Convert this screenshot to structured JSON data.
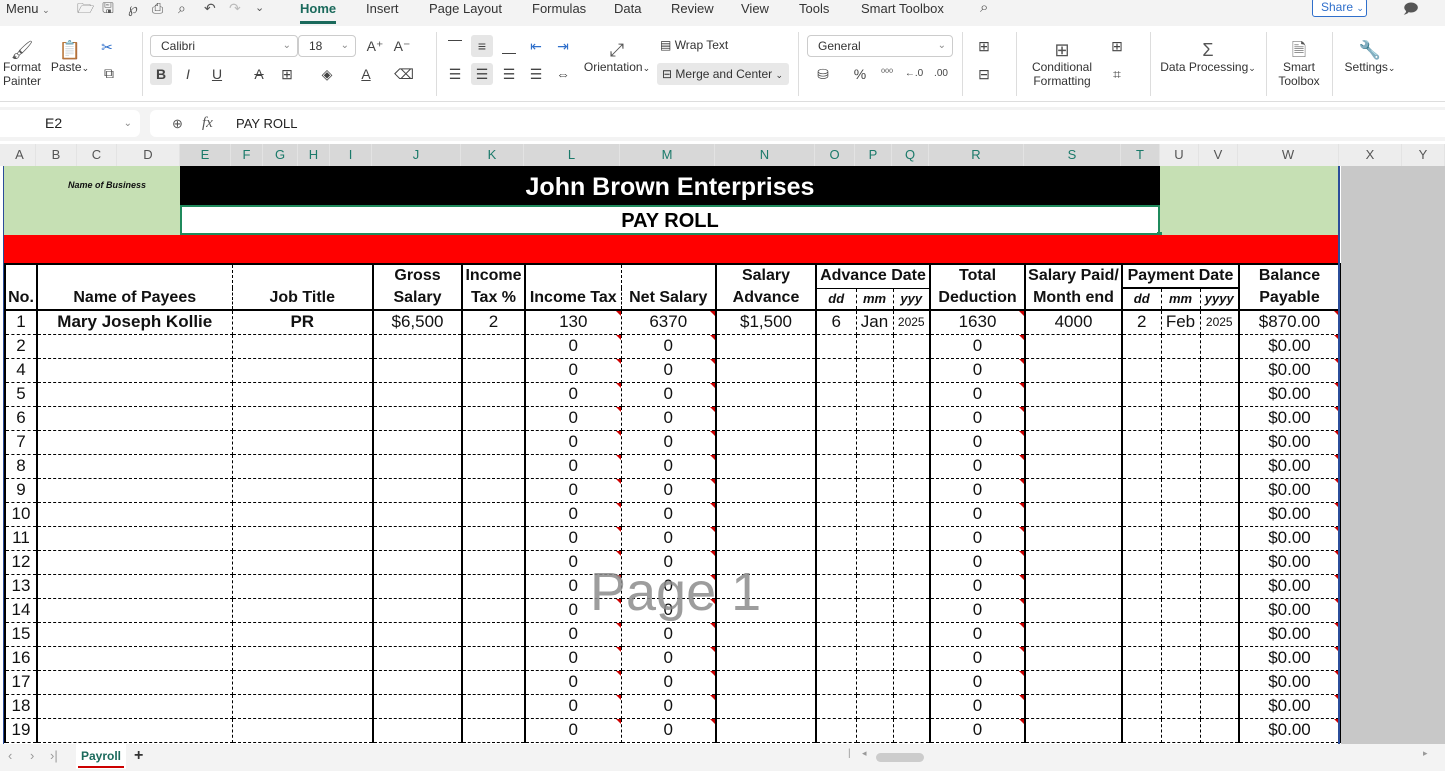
{
  "menubar": {
    "menu_label": "Menu",
    "tabs": [
      "Home",
      "Insert",
      "Page Layout",
      "Formulas",
      "Data",
      "Review",
      "View",
      "Tools",
      "Smart Toolbox"
    ],
    "active_tab": "Home",
    "share_label": "Share"
  },
  "ribbon": {
    "format_painter": "Format Painter",
    "paste": "Paste",
    "font_name": "Calibri",
    "font_size": "18",
    "wrap_text": "Wrap Text",
    "orientation": "Orientation",
    "merge_center": "Merge and Center",
    "number_format": "General",
    "conditional_formatting": "Conditional Formatting",
    "data_processing": "Data Processing",
    "smart_toolbox": "Smart Toolbox",
    "settings": "Settings"
  },
  "formula_bar": {
    "cell_ref": "E2",
    "fx": "fx",
    "content": "PAY ROLL"
  },
  "columns": [
    "A",
    "B",
    "C",
    "D",
    "E",
    "F",
    "G",
    "H",
    "I",
    "J",
    "K",
    "L",
    "M",
    "N",
    "O",
    "P",
    "Q",
    "R",
    "S",
    "T",
    "U",
    "V",
    "W",
    "X",
    "Y"
  ],
  "sheet": {
    "name_of_business_label": "Name of Business",
    "business_name": "John Brown Enterprises",
    "subtitle": "PAY ROLL",
    "watermark": "Page 1",
    "headers": {
      "no": "No.",
      "name": "Name of Payees",
      "job": "Job Title",
      "gross1": "Gross",
      "gross2": "Salary",
      "tax1": "Income",
      "tax2": "Tax %",
      "income_tax": "Income Tax",
      "net": "Net Salary",
      "adv1": "Salary",
      "adv2": "Advance",
      "adv_date": "Advance Date",
      "adv_dd": "dd",
      "adv_mm": "mm",
      "adv_yy": "yyy",
      "ded1": "Total",
      "ded2": "Deduction",
      "paid1": "Salary Paid/",
      "paid2": "Month end",
      "pay_date": "Payment Date",
      "pay_dd": "dd",
      "pay_mm": "mm",
      "pay_yy": "yyyy",
      "bal1": "Balance",
      "bal2": "Payable"
    },
    "rows": [
      {
        "no": "1",
        "name": "Mary Joseph Kollie",
        "job": "PR",
        "gross": "$6,500",
        "tax_pct": "2",
        "income_tax": "130",
        "net": "6370",
        "advance": "$1,500",
        "adv_dd": "6",
        "adv_mm": "Jan",
        "adv_yy": "2025",
        "total_ded": "1630",
        "paid": "4000",
        "pay_dd": "2",
        "pay_mm": "Feb",
        "pay_yy": "2025",
        "balance": "$870.00"
      },
      {
        "no": "2",
        "income_tax": "0",
        "net": "0",
        "total_ded": "0",
        "balance": "$0.00"
      },
      {
        "no": "4",
        "income_tax": "0",
        "net": "0",
        "total_ded": "0",
        "balance": "$0.00"
      },
      {
        "no": "5",
        "income_tax": "0",
        "net": "0",
        "total_ded": "0",
        "balance": "$0.00"
      },
      {
        "no": "6",
        "income_tax": "0",
        "net": "0",
        "total_ded": "0",
        "balance": "$0.00"
      },
      {
        "no": "7",
        "income_tax": "0",
        "net": "0",
        "total_ded": "0",
        "balance": "$0.00"
      },
      {
        "no": "8",
        "income_tax": "0",
        "net": "0",
        "total_ded": "0",
        "balance": "$0.00"
      },
      {
        "no": "9",
        "income_tax": "0",
        "net": "0",
        "total_ded": "0",
        "balance": "$0.00"
      },
      {
        "no": "10",
        "income_tax": "0",
        "net": "0",
        "total_ded": "0",
        "balance": "$0.00"
      },
      {
        "no": "11",
        "income_tax": "0",
        "net": "0",
        "total_ded": "0",
        "balance": "$0.00"
      },
      {
        "no": "12",
        "income_tax": "0",
        "net": "0",
        "total_ded": "0",
        "balance": "$0.00"
      },
      {
        "no": "13",
        "income_tax": "0",
        "net": "0",
        "total_ded": "0",
        "balance": "$0.00"
      },
      {
        "no": "14",
        "income_tax": "0",
        "net": "0",
        "total_ded": "0",
        "balance": "$0.00"
      },
      {
        "no": "15",
        "income_tax": "0",
        "net": "0",
        "total_ded": "0",
        "balance": "$0.00"
      },
      {
        "no": "16",
        "income_tax": "0",
        "net": "0",
        "total_ded": "0",
        "balance": "$0.00"
      },
      {
        "no": "17",
        "income_tax": "0",
        "net": "0",
        "total_ded": "0",
        "balance": "$0.00"
      },
      {
        "no": "18",
        "income_tax": "0",
        "net": "0",
        "total_ded": "0",
        "balance": "$0.00"
      },
      {
        "no": "19",
        "income_tax": "0",
        "net": "0",
        "total_ded": "0",
        "balance": "$0.00"
      }
    ]
  },
  "bottom": {
    "sheet_tab": "Payroll",
    "add_sheet": "+"
  },
  "colors": {
    "accent": "#1b6a5c",
    "title_bg": "#000000",
    "banner_red": "#ff0000",
    "side_green": "#c6e0b4",
    "selection": "#1f8a5c"
  }
}
